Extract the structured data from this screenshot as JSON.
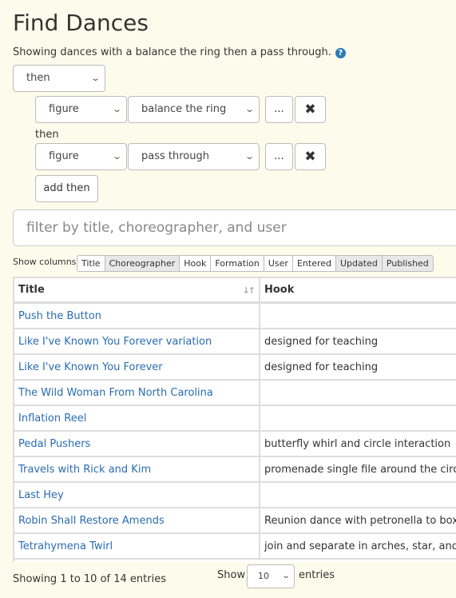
{
  "page": {
    "title": "Find Dances",
    "subtitle": "Showing dances with a balance the ring then a pass through.",
    "help_icon": "question-circle-icon"
  },
  "query": {
    "operator": "then",
    "clauses": [
      {
        "type": "figure",
        "figure": "balance the ring",
        "more_label": "...",
        "remove_icon": "close-icon"
      },
      {
        "type": "figure",
        "figure": "pass through",
        "more_label": "...",
        "remove_icon": "close-icon"
      }
    ],
    "between_label": "then",
    "add_label": "add then"
  },
  "filter": {
    "placeholder": "filter by title, choreographer, and user"
  },
  "columns": {
    "label": "Show columns",
    "toggles": [
      {
        "label": "Title",
        "on": false
      },
      {
        "label": "Choreographer",
        "on": true
      },
      {
        "label": "Hook",
        "on": false
      },
      {
        "label": "Formation",
        "on": false
      },
      {
        "label": "User",
        "on": false
      },
      {
        "label": "Entered",
        "on": false
      },
      {
        "label": "Updated",
        "on": true
      },
      {
        "label": "Published",
        "on": true
      }
    ]
  },
  "table": {
    "headers": [
      "Title",
      "Hook"
    ],
    "rows": [
      {
        "title": "Push the Button",
        "hook": ""
      },
      {
        "title": "Like I've Known You Forever variation",
        "hook": "designed for teaching"
      },
      {
        "title": "Like I've Known You Forever",
        "hook": "designed for teaching"
      },
      {
        "title": "The Wild Woman From North Carolina",
        "hook": ""
      },
      {
        "title": "Inflation Reel",
        "hook": ""
      },
      {
        "title": "Pedal Pushers",
        "hook": "butterfly whirl and circle interaction"
      },
      {
        "title": "Travels with Rick and Kim",
        "hook": "promenade single file around the circle"
      },
      {
        "title": "Last Hey",
        "hook": ""
      },
      {
        "title": "Robin Shall Restore Amends",
        "hook": "Reunion dance with petronella to box circulate"
      },
      {
        "title": "Tetrahymena Twirl",
        "hook": "join and separate in arches, star, and gentle"
      }
    ]
  },
  "footer": {
    "info": "Showing 1 to 10 of 14 entries",
    "show_label": "Show",
    "page_length": "10",
    "entries_label": "entries"
  },
  "colors": {
    "background": "#fdfcec",
    "link": "#2a6cb0",
    "help": "#2a7ab8"
  }
}
